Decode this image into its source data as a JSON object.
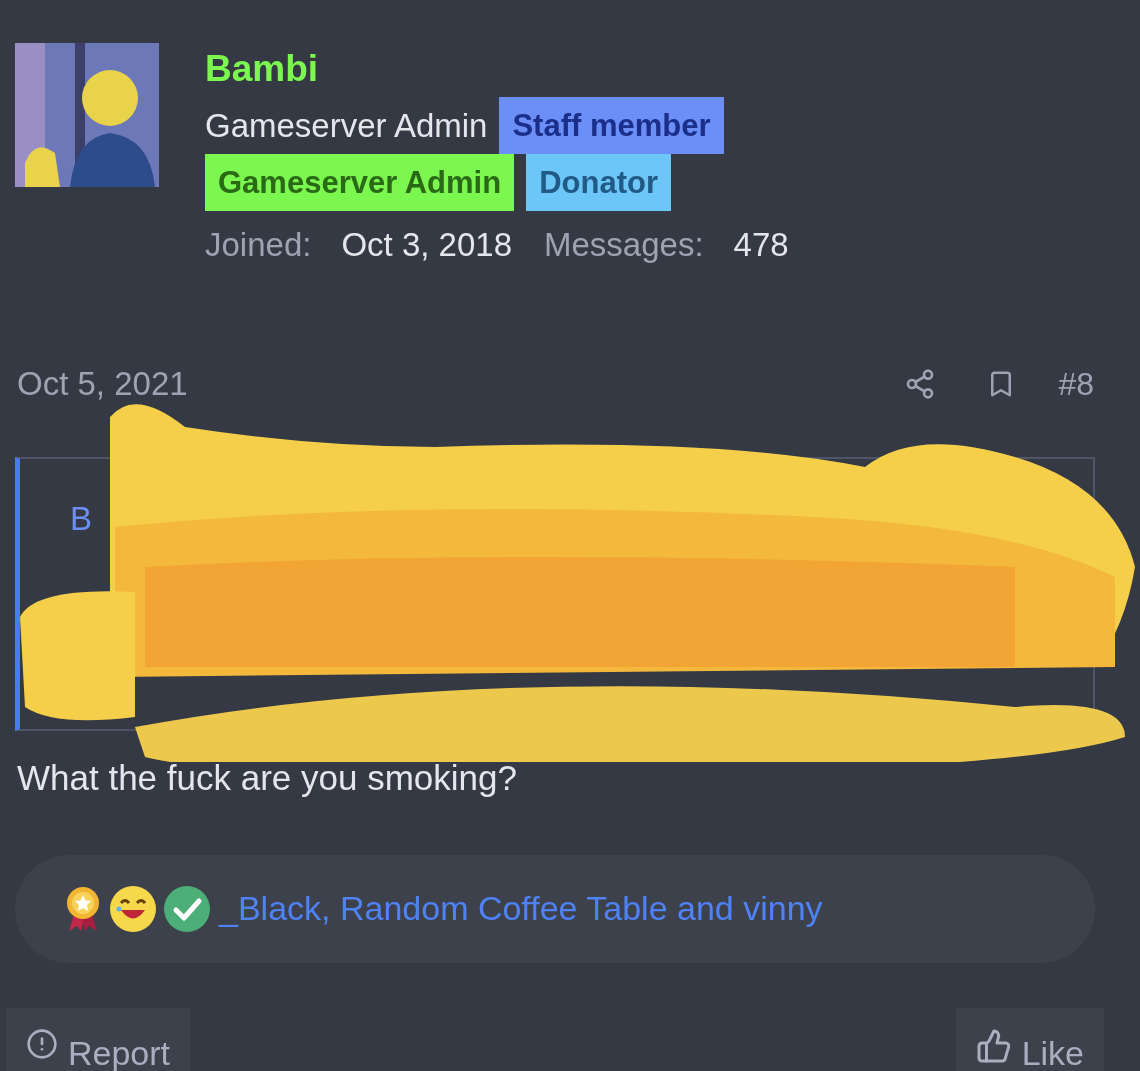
{
  "user": {
    "name": "Bambi",
    "title": "Gameserver Admin",
    "banners": [
      {
        "label": "Staff member",
        "kind": "staff"
      },
      {
        "label": "Gameserver Admin",
        "kind": "admin"
      },
      {
        "label": "Donator",
        "kind": "donator"
      }
    ],
    "stats": [
      {
        "label": "Joined:",
        "value": "Oct 3, 2018"
      },
      {
        "label": "Messages:",
        "value": "478"
      }
    ]
  },
  "post": {
    "date": "Oct 5, 2021",
    "number": "#8",
    "quote": {
      "author": "B"
    },
    "body": "What the fuck are you smoking?",
    "reactions": {
      "icons": [
        {
          "kind": "award"
        },
        {
          "kind": "laugh"
        },
        {
          "kind": "agree"
        }
      ],
      "names": "_Black, Random Coffee Table and vinny"
    },
    "actions": [
      {
        "label": "Report",
        "kind": "report"
      },
      {
        "label": "Like",
        "kind": "like"
      }
    ]
  }
}
